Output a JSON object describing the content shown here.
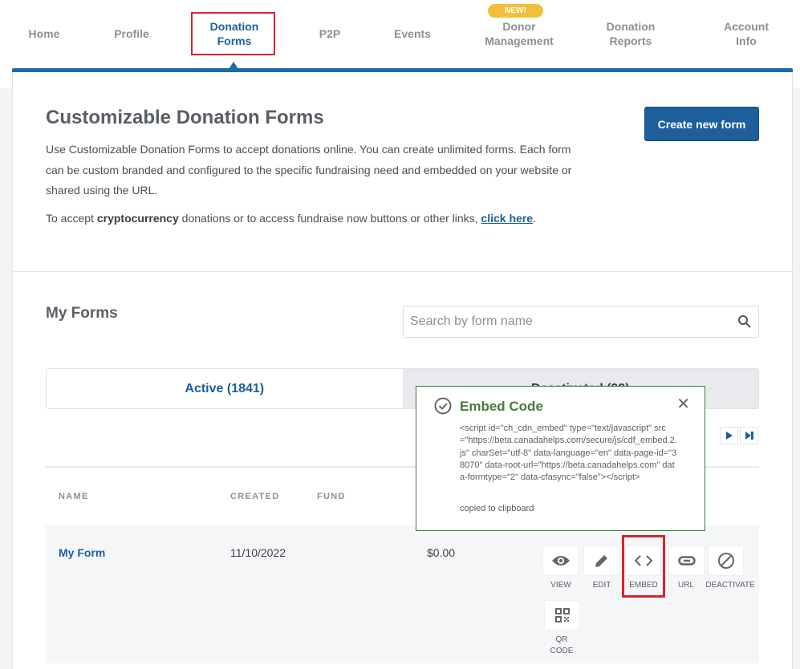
{
  "nav": {
    "items": [
      {
        "label": "Home"
      },
      {
        "label": "Profile"
      },
      {
        "label": "Donation\nForms"
      },
      {
        "label": "P2P"
      },
      {
        "label": "Events"
      },
      {
        "label": "Donor\nManagement"
      },
      {
        "label": "Donation\nReports"
      },
      {
        "label": "Account\nInfo"
      }
    ],
    "active": "Donation Forms",
    "new_badge": "NEW!"
  },
  "header": {
    "title": "Customizable Donation Forms",
    "description": "Use Customizable Donation Forms to accept donations online. You can create unlimited forms. Each form can be custom branded and configured to the specific fundraising need and embedded on your website or shared using the URL.",
    "crypto_prefix": "To accept ",
    "crypto_bold": "cryptocurrency",
    "crypto_suffix": " donations or to access fundraise now buttons or other links, ",
    "crypto_link": "click here",
    "crypto_end": ".",
    "create_button": "Create new form"
  },
  "forms": {
    "title": "My Forms",
    "search_placeholder": "Search by form name",
    "tabs": [
      {
        "label": "Active (1841)"
      },
      {
        "label": "Deactivated (99)"
      }
    ],
    "columns": [
      "NAME",
      "CREATED",
      "FUND"
    ],
    "rows": [
      {
        "name": "My Form",
        "created": "11/10/2022",
        "amount": "$0.00",
        "actions": [
          "VIEW",
          "EDIT",
          "EMBED",
          "URL",
          "DEACTIVATE",
          "QR\nCODE"
        ]
      }
    ]
  },
  "popup": {
    "title": "Embed Code",
    "code": "<script id=\"ch_cdn_embed\" type=\"text/javascript\" src=\"https://beta.canadahelps.com/secure/js/cdf_embed.2.js\" charSet=\"utf-8\" data-language=\"en\" data-page-id=\"38070\" data-root-url=\"https://beta.canadahelps.com\" data-formtype=\"2\" data-cfasync=\"false\"></script>",
    "status": "copied to clipboard"
  },
  "colors": {
    "brand": "#1d5f9a",
    "success": "#4a7a3a",
    "badge": "#f1bf3a",
    "highlight": "#d9232e"
  }
}
